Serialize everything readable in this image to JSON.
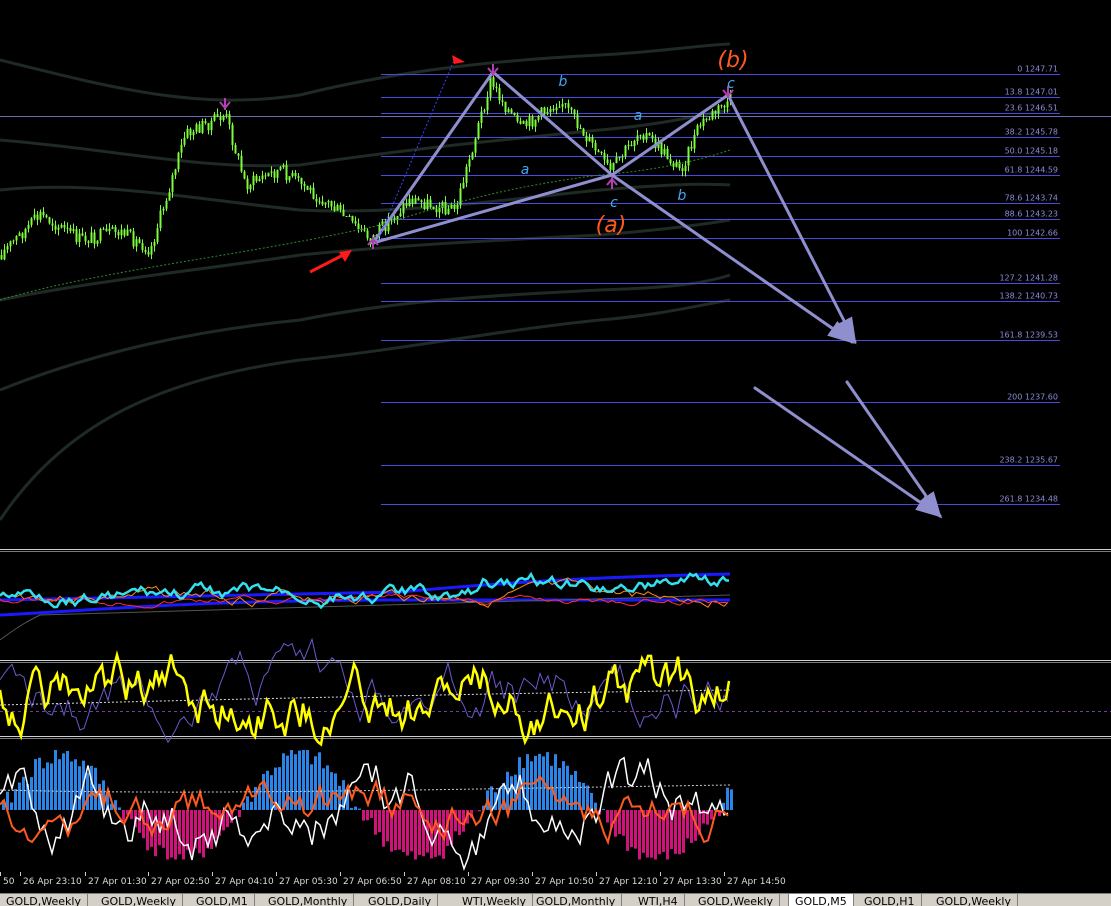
{
  "chart_data": {
    "type": "line",
    "fib_levels": [
      {
        "ratio": "0",
        "price": "1247.71"
      },
      {
        "ratio": "13.8",
        "price": "1247.01"
      },
      {
        "ratio": "23.6",
        "price": "1246.51"
      },
      {
        "ratio": "38.2",
        "price": "1245.78"
      },
      {
        "ratio": "50.0",
        "price": "1245.18"
      },
      {
        "ratio": "61.8",
        "price": "1244.59"
      },
      {
        "ratio": "78.6",
        "price": "1243.74"
      },
      {
        "ratio": "88.6",
        "price": "1243.23"
      },
      {
        "ratio": "100",
        "price": "1242.66"
      },
      {
        "ratio": "127.2",
        "price": "1241.28"
      },
      {
        "ratio": "138.2",
        "price": "1240.73"
      },
      {
        "ratio": "161.8",
        "price": "1239.53"
      },
      {
        "ratio": "200",
        "price": "1237.60"
      },
      {
        "ratio": "238.2",
        "price": "1235.67"
      },
      {
        "ratio": "261.8",
        "price": "1234.48"
      }
    ],
    "wave_labels": [
      {
        "id": "b-major",
        "text": "(b)",
        "color": "#ff5a1e"
      },
      {
        "id": "a-major",
        "text": "(a)",
        "color": "#ff5a1e"
      },
      {
        "id": "c-top",
        "text": "c",
        "color": "#3fa9f5"
      },
      {
        "id": "b-1",
        "text": "b",
        "color": "#3fa9f5"
      },
      {
        "id": "a-1",
        "text": "a",
        "color": "#3fa9f5"
      },
      {
        "id": "c-low",
        "text": "c",
        "color": "#3fa9f5"
      },
      {
        "id": "a-2",
        "text": "a",
        "color": "#3fa9f5"
      },
      {
        "id": "b-2",
        "text": "b",
        "color": "#3fa9f5"
      }
    ],
    "x_ticks": [
      "50",
      "26 Apr 23:10",
      "27 Apr 01:30",
      "27 Apr 02:50",
      "27 Apr 04:10",
      "27 Apr 05:30",
      "27 Apr 06:50",
      "27 Apr 08:10",
      "27 Apr 09:30",
      "27 Apr 10:50",
      "27 Apr 12:10",
      "27 Apr 13:30",
      "27 Apr 14:50"
    ],
    "series": [],
    "grid": false
  },
  "tabs": [
    {
      "label": "GOLD,Weekly",
      "active": false
    },
    {
      "label": "GOLD,Weekly",
      "active": false
    },
    {
      "label": "GOLD,M1",
      "active": false
    },
    {
      "label": "GOLD,Monthly",
      "active": false
    },
    {
      "label": "GOLD,Daily",
      "active": false
    },
    {
      "label": "WTI,Weekly",
      "active": false
    },
    {
      "label": "GOLD,Monthly",
      "active": false
    },
    {
      "label": "WTI,H4",
      "active": false
    },
    {
      "label": "GOLD,Weekly",
      "active": false
    },
    {
      "label": "GOLD,M5",
      "active": true
    },
    {
      "label": "GOLD,H1",
      "active": false
    },
    {
      "label": "GOLD,Weekly",
      "active": false
    }
  ],
  "colors": {
    "background": "#000000",
    "fib_line": "#4a4ae0",
    "arrow": "#8f8fd0",
    "candle": "#7cfc3c",
    "yellow_line": "#ffff00",
    "cyan_line": "#33e0ee",
    "histo_pos": "#2b84e8",
    "histo_neg": "#d0137a",
    "signal_line": "#ff5a1e"
  }
}
